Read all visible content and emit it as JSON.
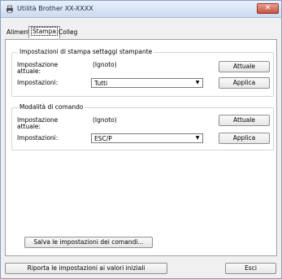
{
  "window": {
    "title": "Utilità Brother XX-XXXX",
    "close_label": "✕"
  },
  "tabs": [
    {
      "label": "Aliment",
      "active": false
    },
    {
      "label": "Stampa",
      "active": true
    },
    {
      "label": "Colleg",
      "active": false
    }
  ],
  "group1": {
    "title": "Impostazioni di stampa settaggi stampante",
    "current_label": "Impostazione attuale:",
    "current_value": "(Ignoto)",
    "settings_label": "Impostazioni:",
    "settings_value": "Tutti",
    "current_button": "Attuale",
    "apply_button": "Applica"
  },
  "group2": {
    "title": "Modalità di comando",
    "current_label": "Impostazione attuale:",
    "current_value": "(Ignoto)",
    "settings_label": "Impostazioni:",
    "settings_value": "ESC/P",
    "current_button": "Attuale",
    "apply_button": "Applica"
  },
  "save_commands_button": "Salva le impostazioni dei comandi...",
  "footer": {
    "reset_button": "Riporta le impostazioni ai valori iniziali",
    "exit_button": "Esci"
  },
  "icons": {
    "app": "printer-icon",
    "dropdown": "triangle-down"
  }
}
